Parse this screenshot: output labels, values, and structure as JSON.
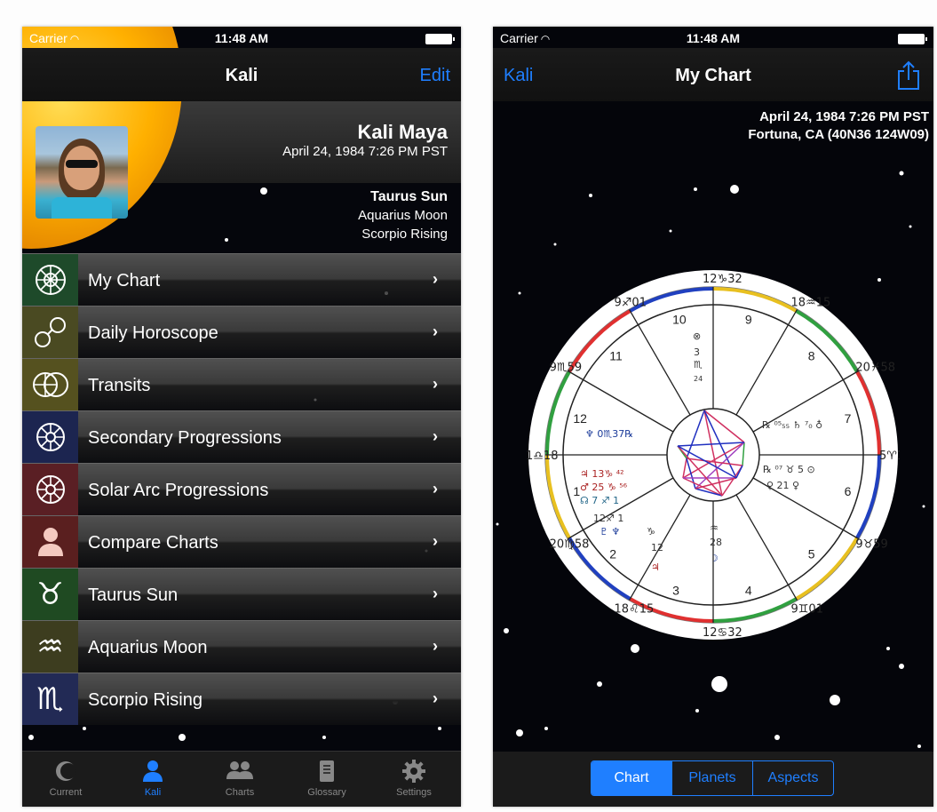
{
  "left": {
    "status": {
      "carrier": "Carrier",
      "time": "11:48 AM"
    },
    "nav": {
      "title": "Kali",
      "edit": "Edit"
    },
    "profile": {
      "name": "Kali Maya",
      "birth": "April 24, 1984 7:26 PM PST",
      "sun": "Taurus Sun",
      "moon": "Aquarius Moon",
      "rising": "Scorpio Rising"
    },
    "menu": [
      {
        "label": "My Chart",
        "icon": "chart-wheel-icon",
        "color": "#1e4a2a"
      },
      {
        "label": "Daily Horoscope",
        "icon": "horoscope-circles-icon",
        "color": "#4a4a22"
      },
      {
        "label": "Transits",
        "icon": "transits-icon",
        "color": "#55511f"
      },
      {
        "label": "Secondary Progressions",
        "icon": "progressions-icon",
        "color": "#1c2550"
      },
      {
        "label": "Solar Arc Progressions",
        "icon": "solar-arc-icon",
        "color": "#5a1f24"
      },
      {
        "label": "Compare Charts",
        "icon": "person-icon",
        "color": "#5a1f1f"
      },
      {
        "label": "Taurus Sun",
        "icon": "taurus-icon",
        "color": "#1f4a22"
      },
      {
        "label": "Aquarius Moon",
        "icon": "aquarius-icon",
        "color": "#3d3d1f"
      },
      {
        "label": "Scorpio Rising",
        "icon": "scorpio-icon",
        "color": "#222a55"
      }
    ],
    "tabs": [
      {
        "label": "Current",
        "icon": "moon-phase-icon"
      },
      {
        "label": "Kali",
        "icon": "person-icon"
      },
      {
        "label": "Charts",
        "icon": "people-icon"
      },
      {
        "label": "Glossary",
        "icon": "book-icon"
      },
      {
        "label": "Settings",
        "icon": "gear-icon"
      }
    ]
  },
  "right": {
    "status": {
      "carrier": "Carrier",
      "time": "11:48 AM"
    },
    "nav": {
      "back": "Kali",
      "title": "My Chart"
    },
    "chart_info": {
      "date": "April 24, 1984 7:26 PM PST",
      "location": "Fortuna, CA  (40N36 124W09)"
    },
    "segments": [
      "Chart",
      "Planets",
      "Aspects"
    ],
    "wheel": {
      "houses": [
        "1",
        "2",
        "3",
        "4",
        "5",
        "6",
        "7",
        "8",
        "9",
        "10",
        "11",
        "12"
      ],
      "cusps": [
        "18♌15",
        "12♋32",
        "9♊01",
        "9♉59",
        "5♈18",
        "20♓58",
        "18♒15",
        "12♑32",
        "9♐01",
        "9♏59",
        "1♎18",
        "20♍58"
      ]
    }
  },
  "colors": {
    "accent": "#1f7fff",
    "sun": "#ffb000"
  }
}
